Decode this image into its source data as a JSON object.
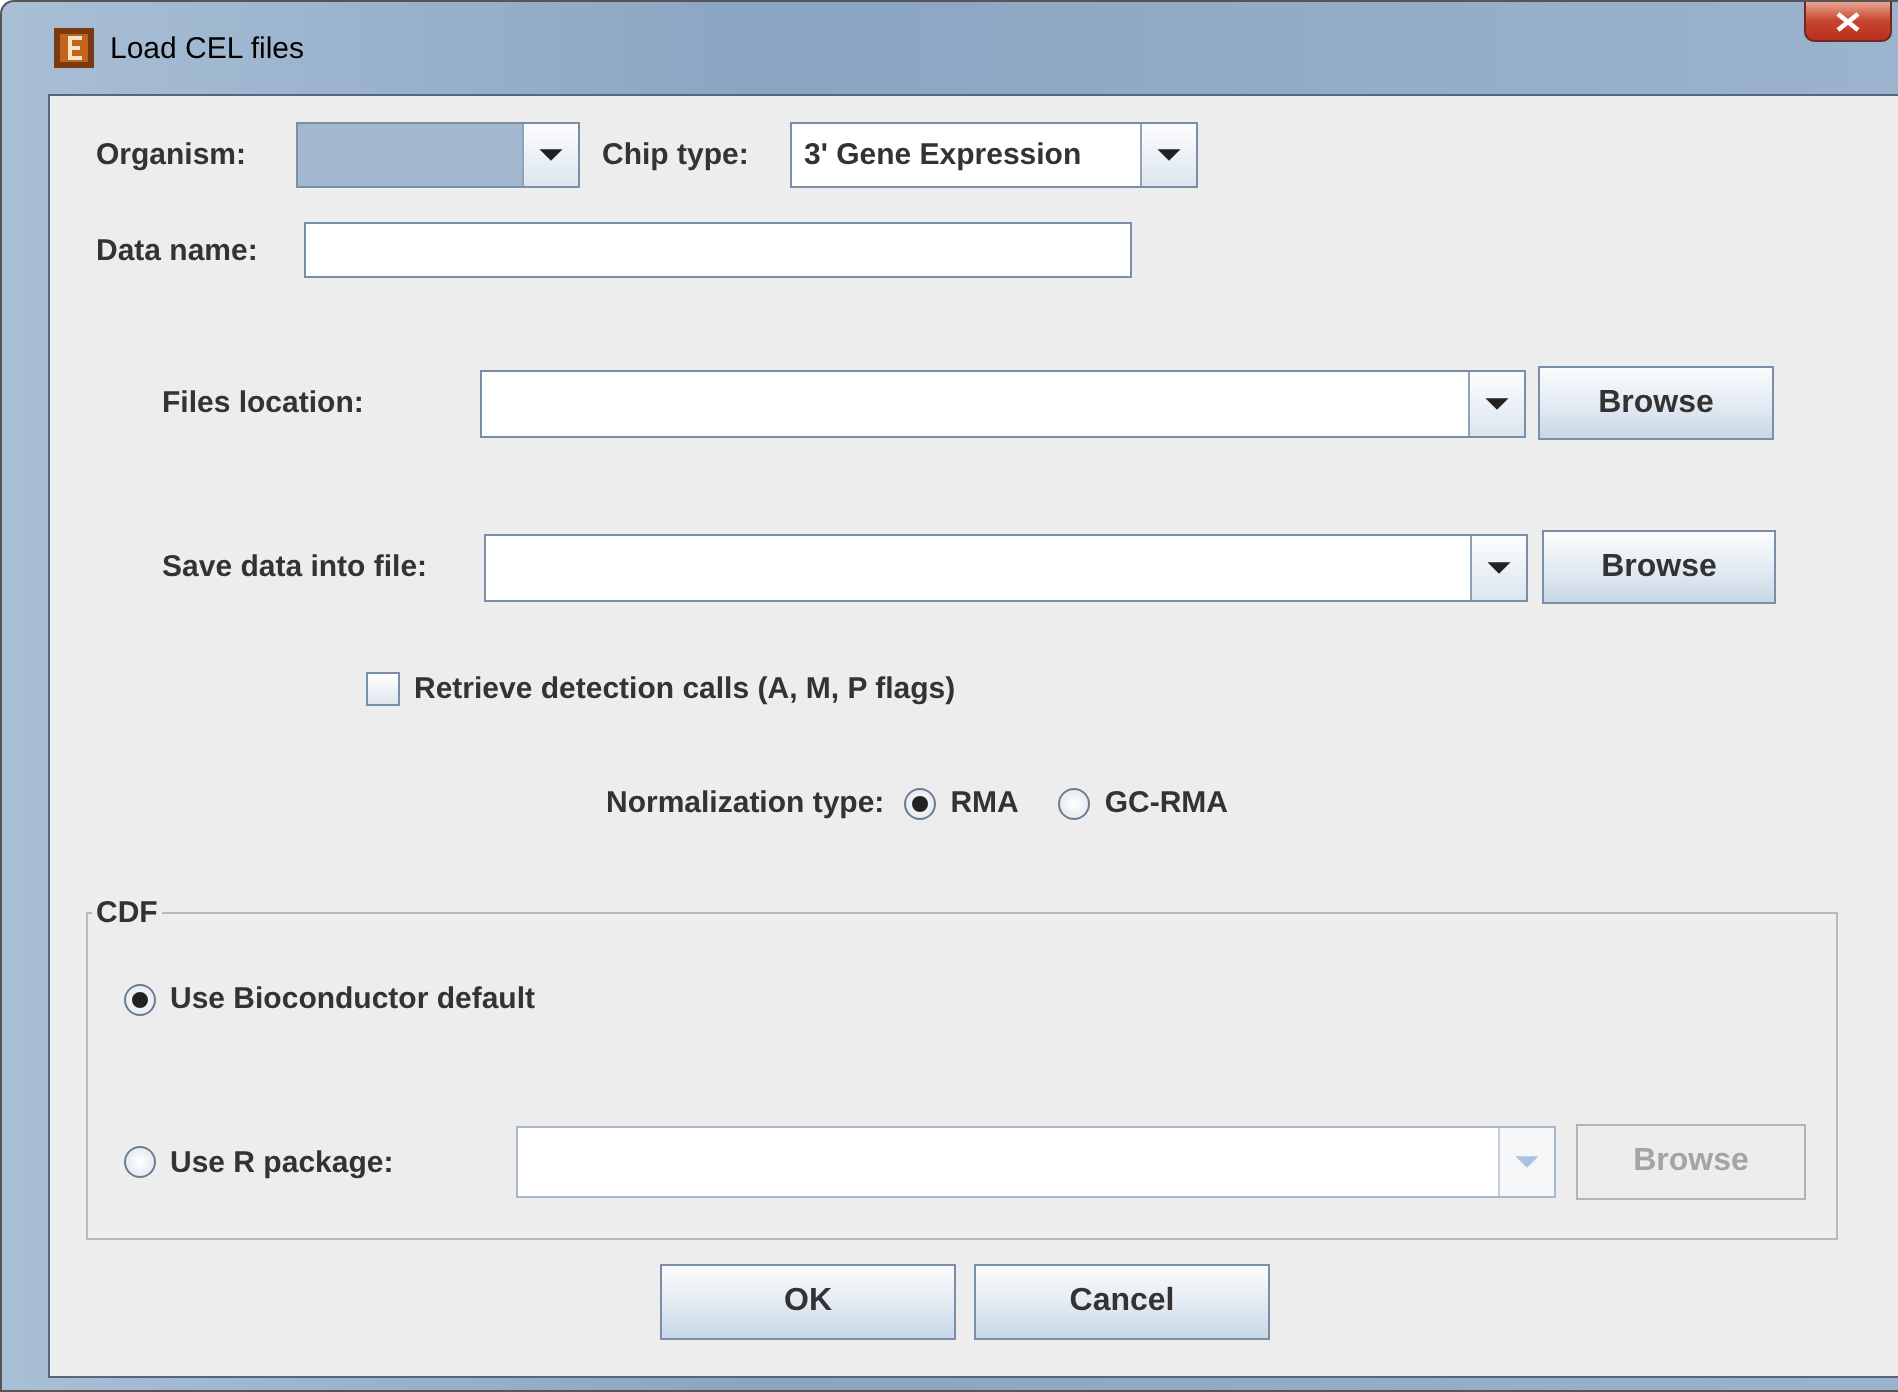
{
  "window": {
    "title": "Load CEL files"
  },
  "organism": {
    "label": "Organism:",
    "highlighted": true
  },
  "chip_type": {
    "label": "Chip type:",
    "value": "3' Gene Expression"
  },
  "data_name": {
    "label": "Data name:"
  },
  "files_location": {
    "label": "Files location:",
    "button": "Browse"
  },
  "save_data": {
    "label": "Save data into file:",
    "button": "Browse"
  },
  "detection_calls": {
    "label": "Retrieve detection calls (A, M, P flags)",
    "checked": false
  },
  "normalization": {
    "label": "Normalization type:",
    "options": [
      {
        "label": "RMA",
        "selected": true
      },
      {
        "label": "GC-RMA",
        "selected": false
      }
    ]
  },
  "cdf": {
    "title": "CDF",
    "options": [
      {
        "label": "Use Bioconductor default",
        "selected": true
      },
      {
        "label": "Use R package:",
        "selected": false
      }
    ],
    "package_disabled": true,
    "button": "Browse",
    "button_disabled": true
  },
  "buttons": [
    "OK",
    "Cancel"
  ]
}
